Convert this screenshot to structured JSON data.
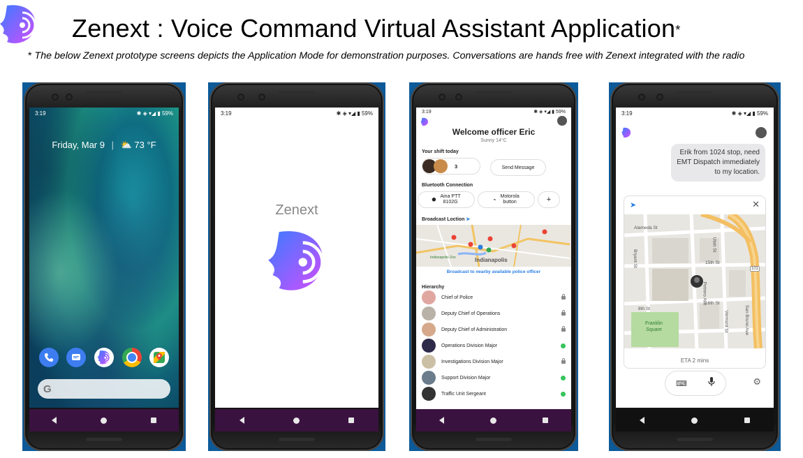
{
  "header": {
    "title": "Zenext : Voice Command Virtual Assistant Application",
    "title_star": "*",
    "subtitle_asterisk": "*",
    "subtitle": "The below Zenext prototype screens depicts the Application Mode for demonstration purposes. Conversations are hands free with Zenext integrated with the radio"
  },
  "colors": {
    "brand_gradient_start": "#3a7bff",
    "brand_gradient_end": "#d24dff",
    "nav_purple": "#3a1240",
    "green": "#36c45a"
  },
  "phone1": {
    "time": "3:19",
    "battery": "59%",
    "date_widget": "Friday, Mar 9",
    "weather": "73 °F",
    "dock_icons": [
      "phone-icon",
      "messages-icon",
      "zenext-icon",
      "chrome-icon",
      "maps-icon"
    ],
    "search_g": "G"
  },
  "phone2": {
    "time": "3:19",
    "battery": "59%",
    "app_name": "Zenext"
  },
  "phone3": {
    "time": "3:19",
    "battery": "59%",
    "welcome": "Welcome officer Eric",
    "weather": "Sunny 14°C",
    "shift_label": "Your shift today",
    "shift_count": "3",
    "send_message": "Send Message",
    "bluetooth_label": "Bluetooth Connection",
    "device1_line1": "Aina PTT",
    "device1_line2": "8102G",
    "device2_line1": "Motorola",
    "device2_line2": "button",
    "add": "+",
    "broadcast_label": "Broadcast Loction",
    "map_city": "Indianapolis",
    "map_zoo": "Indianapolis Zoo",
    "broadcast_link": "Broadcast to nearby available police officer",
    "hierarchy_label": "Hierarchy",
    "hierarchy": [
      {
        "name": "Chief of Police",
        "status": "locked"
      },
      {
        "name": "Deputy Chief of Operations",
        "status": "locked"
      },
      {
        "name": "Deputy Chief of Administration",
        "status": "locked"
      },
      {
        "name": "Operations Division Major",
        "status": "online"
      },
      {
        "name": "Investigations Division Major",
        "status": "locked"
      },
      {
        "name": "Support Division Major",
        "status": "online"
      },
      {
        "name": "Traffic Unit Sergeant",
        "status": "online"
      }
    ]
  },
  "phone4": {
    "time": "3:19",
    "battery": "59%",
    "message_line1": "Erik from 1024 stop, need",
    "message_line2": "EMT Dispatch immediately",
    "message_line3": "to my location.",
    "streets": {
      "alameda": "Alameda St",
      "bryant": "Bryant St",
      "fifteenth": "15th St",
      "sixteenth": "16th St",
      "eighth": "8th St",
      "utah": "Utah St",
      "potrero": "Potrero Ave",
      "sanbruno": "San Bruno Ave",
      "vermont": "Vermont St",
      "highway": "101",
      "park_line1": "Franklin",
      "park_line2": "Square"
    },
    "eta": "ETA 2 mins"
  }
}
